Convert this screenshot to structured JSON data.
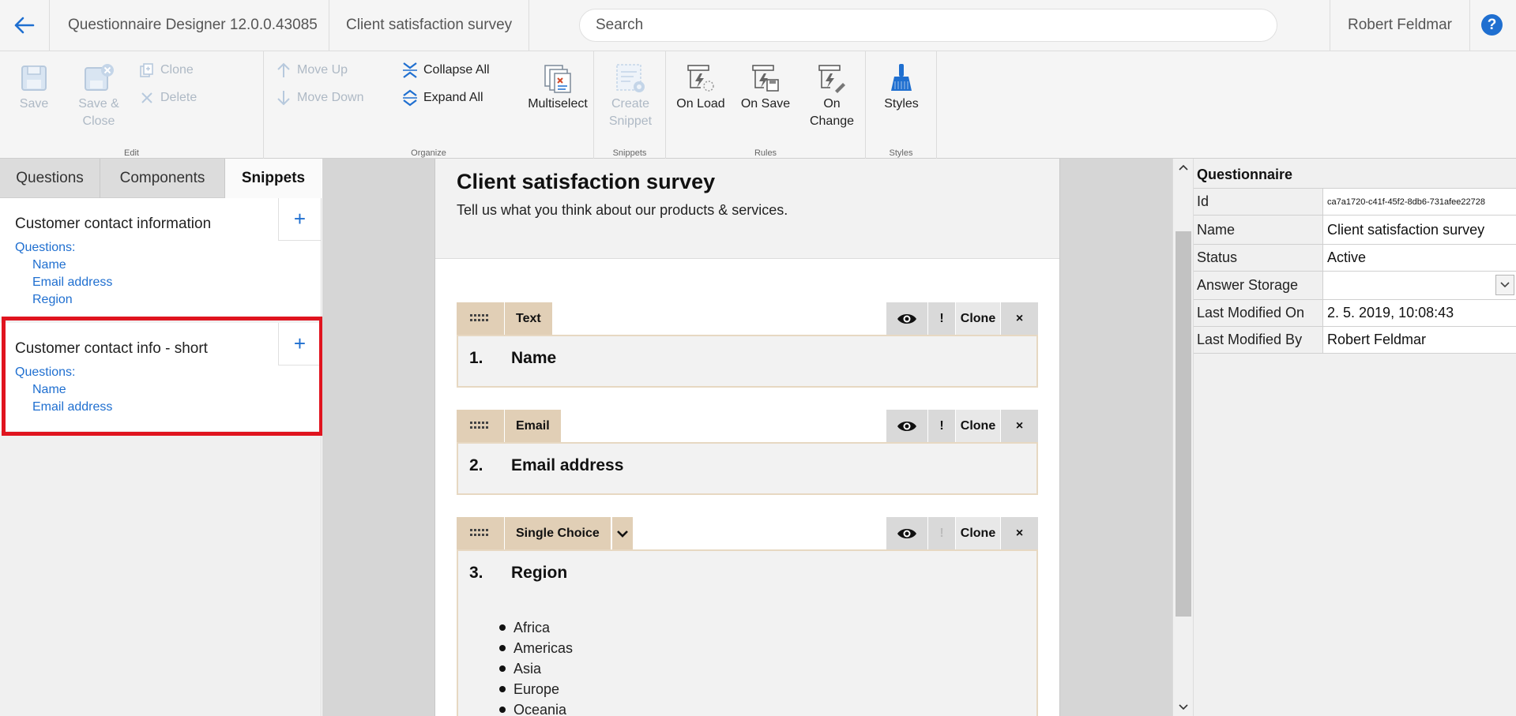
{
  "topbar": {
    "back_icon": "arrow-left-icon",
    "app_title": "Questionnaire Designer 12.0.0.43085",
    "doc_title": "Client satisfaction survey",
    "search_placeholder": "Search",
    "user_name": "Robert Feldmar",
    "help_label": "?"
  },
  "ribbon": {
    "edit": {
      "label": "Edit",
      "save": "Save",
      "save_close": "Save & Close",
      "clone": "Clone",
      "delete": "Delete"
    },
    "organize": {
      "label": "Organize",
      "move_up": "Move Up",
      "move_down": "Move Down",
      "collapse_all": "Collapse All",
      "expand_all": "Expand All",
      "multiselect": "Multiselect"
    },
    "snippets": {
      "label": "Snippets",
      "create_snippet": "Create Snippet"
    },
    "rules": {
      "label": "Rules",
      "on_load": "On Load",
      "on_save": "On Save",
      "on_change": "On Change"
    },
    "styles": {
      "label": "Styles",
      "styles": "Styles"
    }
  },
  "left": {
    "tabs": [
      "Questions",
      "Components",
      "Snippets"
    ],
    "active_tab": "Snippets",
    "snippets": [
      {
        "title": "Customer contact information",
        "questions_label": "Questions:",
        "items": [
          "Name",
          "Email address",
          "Region"
        ]
      },
      {
        "title": "Customer contact info - short",
        "questions_label": "Questions:",
        "items": [
          "Name",
          "Email address"
        ]
      }
    ],
    "add_symbol": "+"
  },
  "page": {
    "title": "Client satisfaction survey",
    "subtitle": "Tell us what you think about our products & services.",
    "questions": [
      {
        "type": "Text",
        "number": "1.",
        "label": "Name"
      },
      {
        "type": "Email",
        "number": "2.",
        "label": "Email address"
      },
      {
        "type": "Single Choice",
        "number": "3.",
        "label": "Region",
        "options": [
          "Africa",
          "Americas",
          "Asia",
          "Europe",
          "Oceania"
        ]
      }
    ],
    "actions": {
      "required": "!",
      "clone": "Clone",
      "remove": "×"
    }
  },
  "properties": {
    "title": "Questionnaire",
    "rows": [
      {
        "key": "Id",
        "value": "ca7a1720-c41f-45f2-8db6-731afee22728"
      },
      {
        "key": "Name",
        "value": "Client satisfaction survey"
      },
      {
        "key": "Status",
        "value": "Active"
      },
      {
        "key": "Answer Storage",
        "value": ""
      },
      {
        "key": "Last Modified On",
        "value": "2. 5. 2019, 10:08:43"
      },
      {
        "key": "Last Modified By",
        "value": "Robert Feldmar"
      }
    ]
  },
  "colors": {
    "accent": "#1f6fd0",
    "highlight": "#e0141f",
    "question_tag": "#e1cfb6",
    "disabled": "#aeb9c5"
  }
}
